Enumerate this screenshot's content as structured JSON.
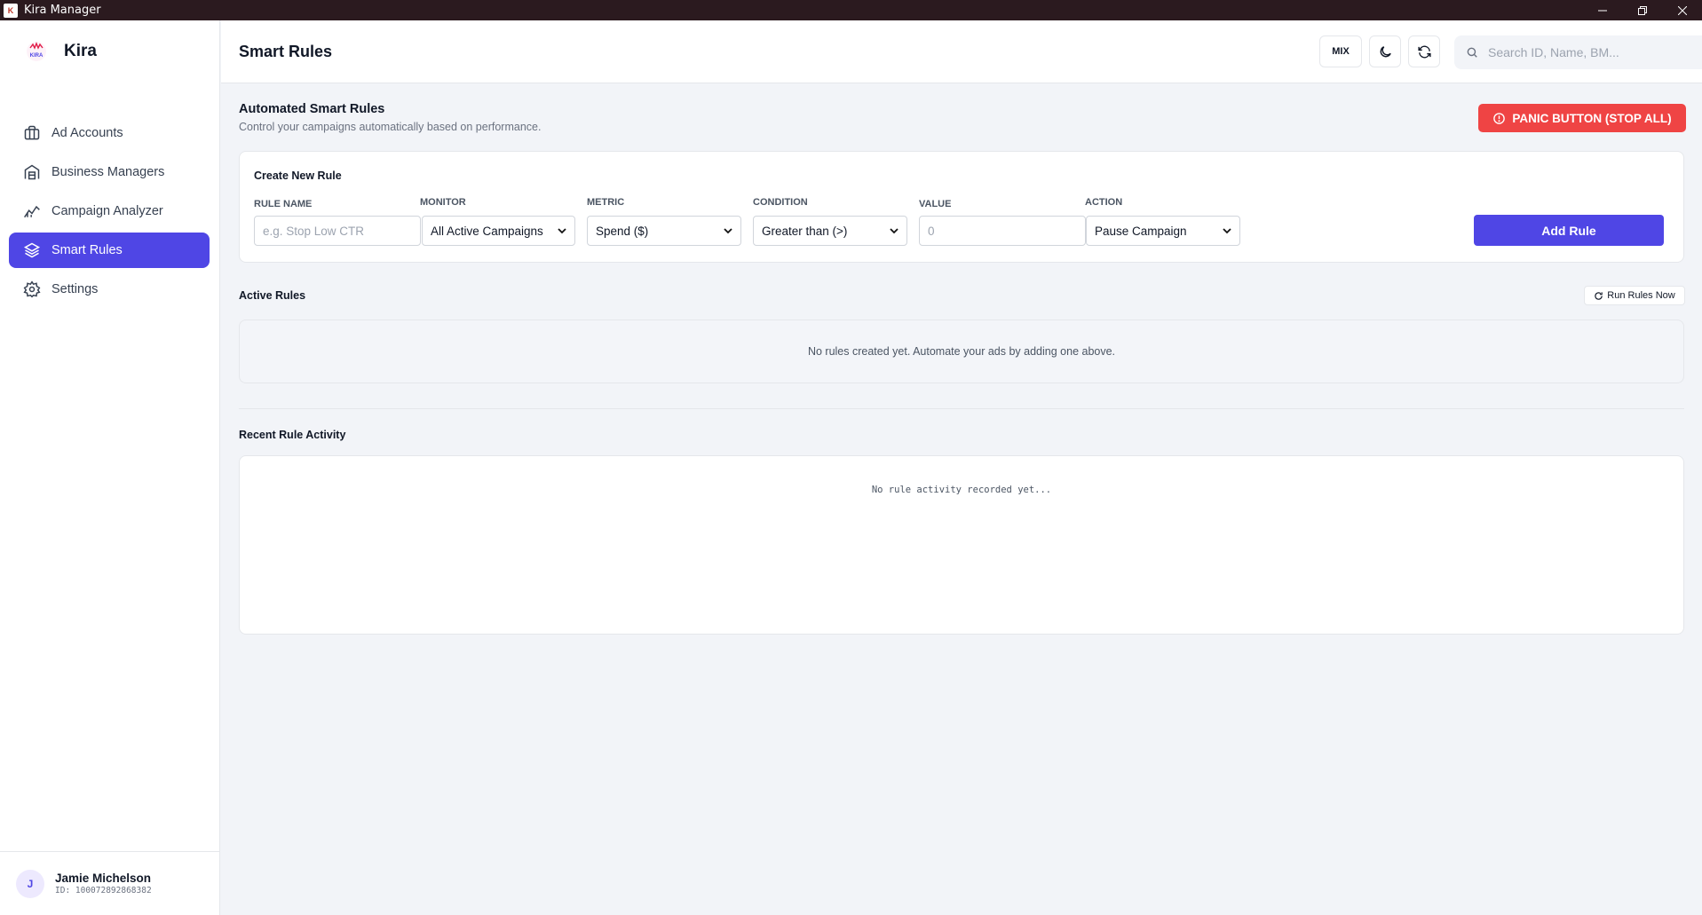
{
  "window": {
    "title": "Kira Manager"
  },
  "sidebar": {
    "brand": "Kira",
    "items": [
      {
        "label": "Ad Accounts",
        "icon": "briefcase-icon",
        "active": false
      },
      {
        "label": "Business Managers",
        "icon": "building-icon",
        "active": false
      },
      {
        "label": "Campaign Analyzer",
        "icon": "chart-icon",
        "active": false
      },
      {
        "label": "Smart Rules",
        "icon": "layers-icon",
        "active": true
      },
      {
        "label": "Settings",
        "icon": "gear-icon",
        "active": false
      }
    ],
    "user": {
      "initial": "J",
      "name": "Jamie Michelson",
      "id": "ID: 100072892868382"
    }
  },
  "header": {
    "title": "Smart Rules",
    "mix_label": "MIX",
    "search_placeholder": "Search ID, Name, BM..."
  },
  "main": {
    "section_title": "Automated Smart Rules",
    "section_subtitle": "Control your campaigns automatically based on performance.",
    "panic_label": "PANIC BUTTON (STOP ALL)",
    "create": {
      "title": "Create New Rule",
      "rule_name_label": "RULE NAME",
      "rule_name_placeholder": "e.g. Stop Low CTR",
      "monitor_label": "MONITOR",
      "monitor_value": "All Active Campaigns",
      "metric_label": "METRIC",
      "metric_value": "Spend ($)",
      "condition_label": "CONDITION",
      "condition_value": "Greater than (>)",
      "value_label": "VALUE",
      "value_placeholder": "0",
      "action_label": "ACTION",
      "action_value": "Pause Campaign",
      "add_label": "Add Rule"
    },
    "active_title": "Active Rules",
    "run_label": "Run Rules Now",
    "empty_rules": "No rules created yet. Automate your ads by adding one above.",
    "recent_title": "Recent Rule Activity",
    "activity_empty": "No rule activity recorded yet..."
  },
  "colors": {
    "accent": "#4f46e5",
    "danger": "#ef4444",
    "titlebar": "#2b1a1f"
  }
}
